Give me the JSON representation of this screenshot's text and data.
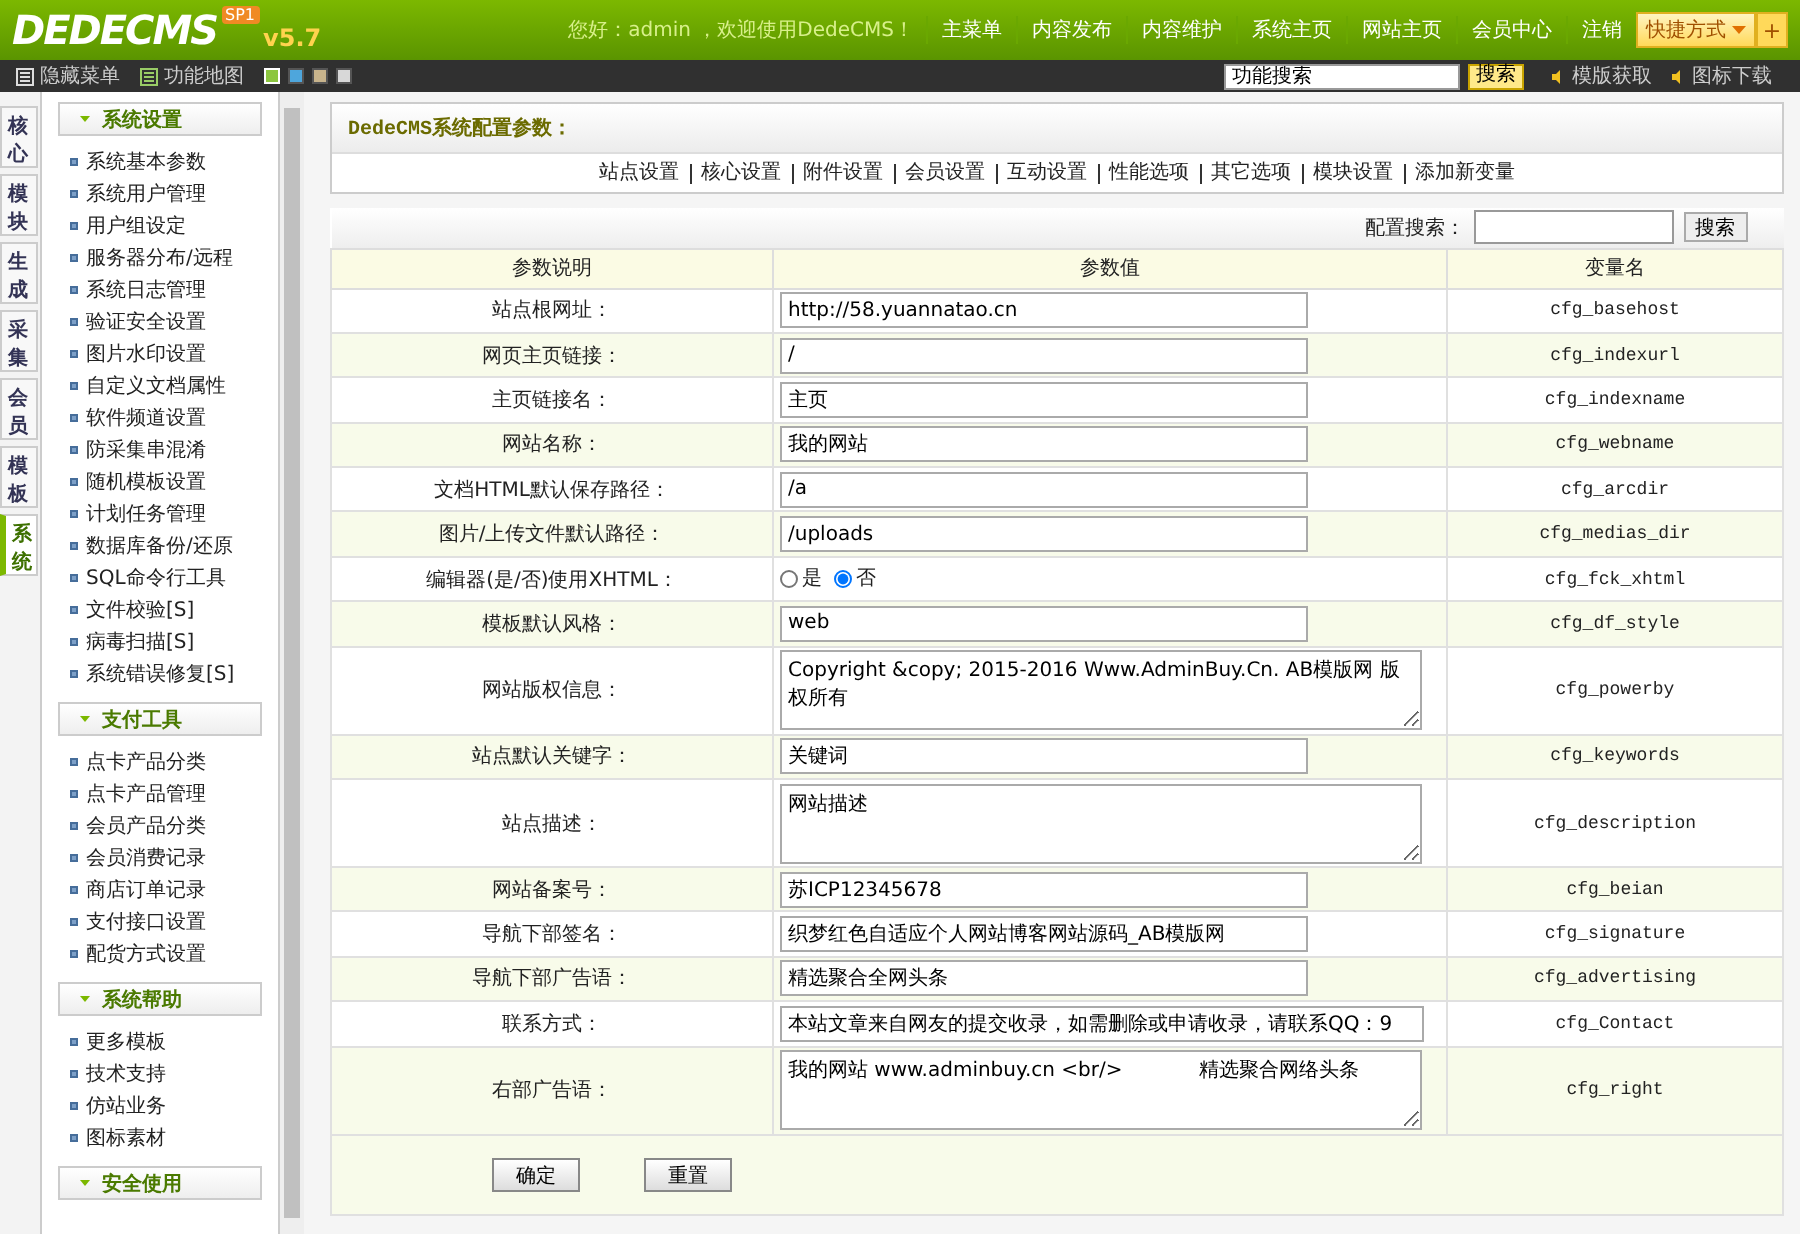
{
  "header": {
    "logo": "DEDECMS",
    "badge": "SP1",
    "version": "v5.7",
    "greeting": "您好：admin ，欢迎使用DedeCMS！",
    "nav": [
      "主菜单",
      "内容发布",
      "内容维护",
      "系统主页",
      "网站主页",
      "会员中心",
      "注销"
    ],
    "shortcut": "快捷方式",
    "add_label": "+"
  },
  "toolbar": {
    "hide_menu": "隐藏菜单",
    "site_map": "功能地图",
    "themes": [
      {
        "color": "#8cc63f",
        "selected": true
      },
      {
        "color": "#4ea6dc",
        "selected": false
      },
      {
        "color": "#c8b48c",
        "selected": false
      },
      {
        "color": "#d8d8d8",
        "selected": false
      }
    ],
    "search_value": "功能搜索",
    "search_button": "搜索",
    "links": [
      "模版获取",
      "图标下载"
    ]
  },
  "vtabs": [
    {
      "label": "核心",
      "selected": false
    },
    {
      "label": "模块",
      "selected": false
    },
    {
      "label": "生成",
      "selected": false
    },
    {
      "label": "采集",
      "selected": false
    },
    {
      "label": "会员",
      "selected": false
    },
    {
      "label": "模板",
      "selected": false
    },
    {
      "label": "系统",
      "selected": true
    }
  ],
  "sidebar": {
    "sections": [
      {
        "title": "系统设置",
        "items": [
          "系统基本参数",
          "系统用户管理",
          "用户组设定",
          "服务器分布/远程",
          "系统日志管理",
          "验证安全设置",
          "图片水印设置",
          "自定义文档属性",
          "软件频道设置",
          "防采集串混淆",
          "随机模板设置",
          "计划任务管理",
          "数据库备份/还原",
          "SQL命令行工具",
          "文件校验[S]",
          "病毒扫描[S]",
          "系统错误修复[S]"
        ]
      },
      {
        "title": "支付工具",
        "items": [
          "点卡产品分类",
          "点卡产品管理",
          "会员产品分类",
          "会员消费记录",
          "商店订单记录",
          "支付接口设置",
          "配货方式设置"
        ]
      },
      {
        "title": "系统帮助",
        "items": [
          "更多模板",
          "技术支持",
          "仿站业务",
          "图标素材"
        ]
      },
      {
        "title": "安全使用"
      }
    ]
  },
  "panel": {
    "title": "DedeCMS系统配置参数：",
    "tabs": [
      "站点设置",
      "核心设置",
      "附件设置",
      "会员设置",
      "互动设置",
      "性能选项",
      "其它选项",
      "模块设置",
      "添加新变量"
    ]
  },
  "config": {
    "search_label": "配置搜索：",
    "search_button": "搜索",
    "columns": [
      "参数说明",
      "参数值",
      "变量名"
    ],
    "rows": [
      {
        "kind": "input",
        "label": "站点根网址：",
        "value": "http://58.yuannatao.cn",
        "var": "cfg_basehost"
      },
      {
        "kind": "input",
        "label": "网页主页链接：",
        "value": "/",
        "var": "cfg_indexurl"
      },
      {
        "kind": "input",
        "label": "主页链接名：",
        "value": "主页",
        "var": "cfg_indexname"
      },
      {
        "kind": "input",
        "label": "网站名称：",
        "value": "我的网站",
        "var": "cfg_webname"
      },
      {
        "kind": "input",
        "label": "文档HTML默认保存路径：",
        "value": "/a",
        "var": "cfg_arcdir"
      },
      {
        "kind": "input",
        "label": "图片/上传文件默认路径：",
        "value": "/uploads",
        "var": "cfg_medias_dir"
      },
      {
        "kind": "radio",
        "label": "编辑器(是/否)使用XHTML：",
        "options": [
          {
            "label": "是",
            "selected": false
          },
          {
            "label": "否",
            "selected": true
          }
        ],
        "var": "cfg_fck_xhtml"
      },
      {
        "kind": "input",
        "label": "模板默认风格：",
        "value": "web",
        "var": "cfg_df_style"
      },
      {
        "kind": "textarea",
        "label": "网站版权信息：",
        "value": "Copyright &copy; 2015-2016 Www.AdminBuy.Cn. AB模版网 版权所有",
        "var": "cfg_powerby"
      },
      {
        "kind": "input",
        "label": "站点默认关键字：",
        "value": "关键词",
        "var": "cfg_keywords"
      },
      {
        "kind": "textarea",
        "label": "站点描述：",
        "value": "网站描述",
        "var": "cfg_description"
      },
      {
        "kind": "input",
        "label": "网站备案号：",
        "value": "苏ICP12345678",
        "var": "cfg_beian"
      },
      {
        "kind": "input",
        "label": "导航下部签名：",
        "value": "织梦红色自适应个人网站博客网站源码_AB模版网",
        "var": "cfg_signature"
      },
      {
        "kind": "input",
        "label": "导航下部广告语：",
        "value": "精选聚合全网头条",
        "var": "cfg_advertising"
      },
      {
        "kind": "input",
        "label": "联系方式：",
        "value": "本站文章来自网友的提交收录，如需删除或申请收录，请联系QQ：9",
        "var": "cfg_Contact"
      },
      {
        "kind": "textarea",
        "label": "右部广告语：",
        "value": "我的网站 www.adminbuy.cn <br/>            精选聚合网络头条",
        "var": "cfg_right"
      }
    ],
    "buttons": [
      "确定",
      "重置"
    ]
  }
}
